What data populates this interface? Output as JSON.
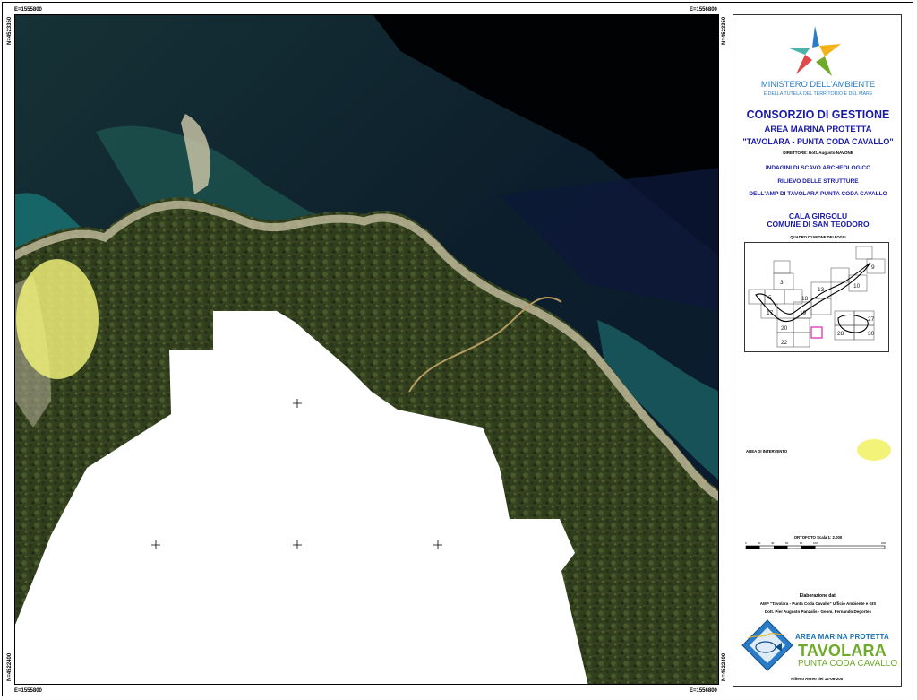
{
  "coords": {
    "top_left": "E=1555800",
    "top_right": "E=1556800",
    "bottom_left": "E=1555800",
    "bottom_right": "E=1556800",
    "left_top": "N=4523350",
    "left_bottom": "N=4522400",
    "right_top": "N=4523350",
    "right_bottom": "N=4522400"
  },
  "panel": {
    "ministero": "MINISTERO DELL'AMBIENTE",
    "ministero_sub": "E DELLA TUTELA DEL TERRITORIO E DEL MARE",
    "consorzio": "CONSORZIO DI GESTIONE",
    "area": "AREA MARINA PROTETTA",
    "tavolara": "\"TAVOLARA - PUNTA CODA CAVALLO\"",
    "direttore": "DIRETTORE: Dott. Augusto NAVONE",
    "indagini": "INDAGINI DI SCAVO ARCHEOLOGICO",
    "rilievo": "RILIEVO DELLE STRUTTURE",
    "dellamp": "DELL'AMP DI TAVOLARA  PUNTA CODA CAVALLO",
    "cala": "CALA GIRGOLU",
    "comune": "COMUNE DI SAN TEODORO",
    "quadro": "QUADRO D'UNIONE DEI FOGLI",
    "sheets": [
      "3",
      "5",
      "9",
      "10",
      "13",
      "17",
      "18",
      "19",
      "20",
      "22",
      "27",
      "28",
      "30"
    ],
    "legend_label": "AREA DI INTERVENTO",
    "scale_title": "ORTOFOTO Scala 1: 2.000",
    "scale_ticks": [
      "0",
      "20",
      "40",
      "60",
      "80",
      "100",
      "200"
    ],
    "elab": "Elaborazione dati",
    "elab_line": "AMP \"Tavolara - Punta Coda Cavallo\"  Ufficio Ambiente e GIS",
    "elab_names": "Dott. Pier Augusto Panzalis - Geom. Fernando Degortes",
    "amp_title": "AREA MARINA PROTETTA",
    "amp_tav": "TAVOLARA",
    "amp_punta": "PUNTA CODA CAVALLO",
    "rilievo_date": "Rilievo Aereo del 12-06-2007"
  },
  "colors": {
    "title_blue": "#1a1aa8",
    "ministero_blue": "#2a7cc7",
    "area_intervento": "#f3f37a",
    "highlight_sheet": "#e040c0",
    "logo_green": "#6faa2b"
  }
}
